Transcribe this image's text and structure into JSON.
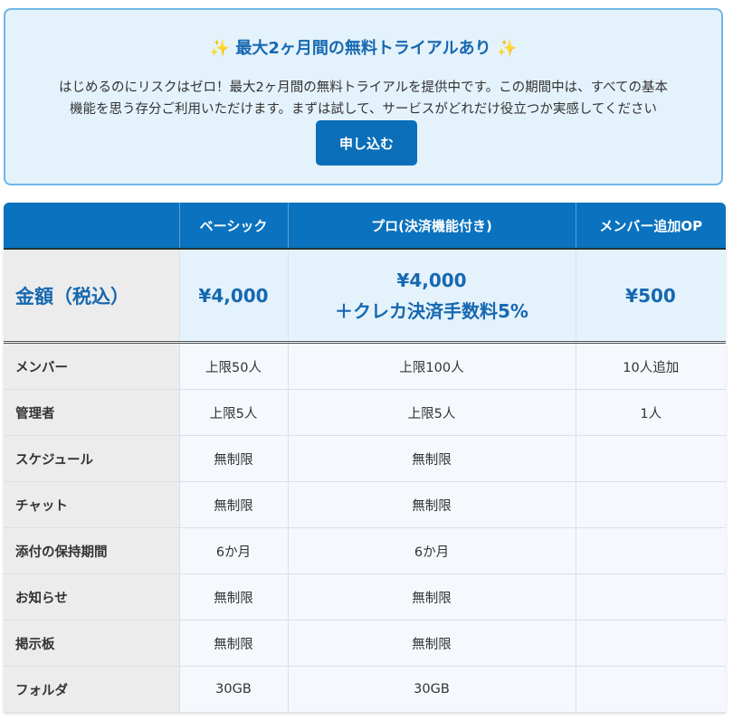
{
  "trial": {
    "sparkle": "✨",
    "title": "最大2ヶ月間の無料トライアルあり",
    "desc_line1": "はじめるのにリスクはゼロ！最大2ヶ月間の無料トライアルを提供中です。この期間中は、すべての基本",
    "desc_line2": "機能を思う存分ご利用いただけます。まずは試して、サービスがどれだけ役立つか実感してください",
    "button": "申し込む"
  },
  "table": {
    "headers": [
      "",
      "ベーシック",
      "プロ(決済機能付き)",
      "メンバー追加OP"
    ],
    "price": {
      "label": "金額（税込）",
      "basic": "¥4,000",
      "pro_line1": "¥4,000",
      "pro_line2": "＋クレカ決済手数料5%",
      "option": "¥500"
    },
    "rows": [
      {
        "label": "メンバー",
        "basic": "上限50人",
        "pro": "上限100人",
        "option": "10人追加"
      },
      {
        "label": "管理者",
        "basic": "上限5人",
        "pro": "上限5人",
        "option": "1人"
      },
      {
        "label": "スケジュール",
        "basic": "無制限",
        "pro": "無制限",
        "option": ""
      },
      {
        "label": "チャット",
        "basic": "無制限",
        "pro": "無制限",
        "option": ""
      },
      {
        "label": "添付の保持期間",
        "basic": "6か月",
        "pro": "6か月",
        "option": ""
      },
      {
        "label": "お知らせ",
        "basic": "無制限",
        "pro": "無制限",
        "option": ""
      },
      {
        "label": "掲示板",
        "basic": "無制限",
        "pro": "無制限",
        "option": ""
      },
      {
        "label": "フォルダ",
        "basic": "30GB",
        "pro": "30GB",
        "option": ""
      }
    ]
  }
}
